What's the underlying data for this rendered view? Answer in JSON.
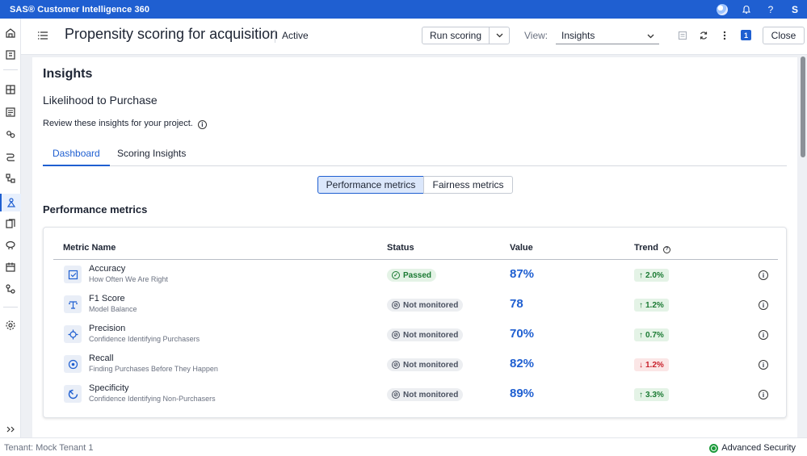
{
  "app": {
    "title": "SAS® Customer Intelligence 360",
    "user_initial": "S",
    "help": "?"
  },
  "header": {
    "title": "Propensity scoring for acquisition",
    "status": "Active",
    "run_scoring": "Run scoring",
    "view_label": "View:",
    "view_value": "Insights",
    "badge": "1",
    "close": "Close"
  },
  "page": {
    "heading": "Insights",
    "subheading": "Likelihood to Purchase",
    "description": "Review these insights for your project."
  },
  "tabs": [
    {
      "label": "Dashboard",
      "active": true
    },
    {
      "label": "Scoring Insights",
      "active": false
    }
  ],
  "segments": {
    "performance": "Performance metrics",
    "fairness": "Fairness metrics"
  },
  "section_title": "Performance metrics",
  "table": {
    "headers": {
      "name": "Metric Name",
      "status": "Status",
      "value": "Value",
      "trend": "Trend"
    },
    "rows": [
      {
        "name": "Accuracy",
        "sub": "How Often We Are Right",
        "status": "Passed",
        "status_type": "pass",
        "value": "87%",
        "trend": "2.0%",
        "trend_dir": "up",
        "icon": "check-square-icon"
      },
      {
        "name": "F1 Score",
        "sub": "Model Balance",
        "status": "Not monitored",
        "status_type": "nm",
        "value": "78",
        "trend": "1.2%",
        "trend_dir": "up",
        "icon": "balance-icon"
      },
      {
        "name": "Precision",
        "sub": "Confidence Identifying Purchasers",
        "status": "Not monitored",
        "status_type": "nm",
        "value": "70%",
        "trend": "0.7%",
        "trend_dir": "up",
        "icon": "crosshair-icon"
      },
      {
        "name": "Recall",
        "sub": "Finding Purchases Before They Happen",
        "status": "Not monitored",
        "status_type": "nm",
        "value": "82%",
        "trend": "1.2%",
        "trend_dir": "down",
        "icon": "recall-icon"
      },
      {
        "name": "Specificity",
        "sub": "Confidence Identifying Non-Purchasers",
        "status": "Not monitored",
        "status_type": "nm",
        "value": "89%",
        "trend": "3.3%",
        "trend_dir": "up",
        "icon": "specificity-icon"
      }
    ]
  },
  "footer": {
    "tenant": "Tenant: Mock Tenant 1",
    "security": "Advanced Security"
  },
  "colors": {
    "brand": "#1f5fd1",
    "pass": "#1b7a33",
    "down": "#c8202b"
  }
}
